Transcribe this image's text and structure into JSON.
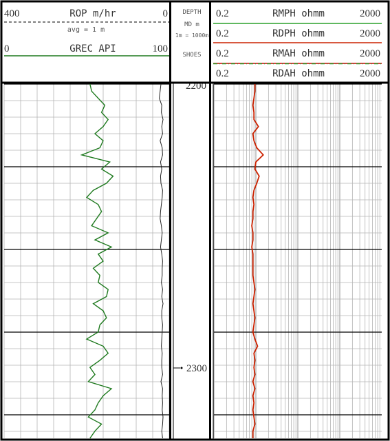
{
  "colors": {
    "frame": "#000000",
    "grid": "#b4b4b4",
    "major_grid": "#000000",
    "grec": "#1f7a1f",
    "rop": "#202020",
    "rdph": "#cc2200",
    "rmph": "#2aa02a",
    "rmah": "#cc0000",
    "rdah": "#2aa02a",
    "text": "#333333"
  },
  "header": {
    "left": {
      "rop_min": "400",
      "rop_label": "ROP m/hr",
      "rop_max": "0",
      "rop_avg": "avg = 1 m",
      "grec_min": "0",
      "grec_label": "GREC API",
      "grec_max": "100"
    },
    "depth": {
      "line1": "DEPTH",
      "line2": "MD m",
      "line3": "1m = 1000m",
      "line4": "SHOES"
    },
    "right": [
      {
        "min": "0.2",
        "label": "RMPH ohmm",
        "max": "2000"
      },
      {
        "min": "0.2",
        "label": "RDPH ohmm",
        "max": "2000"
      },
      {
        "min": "0.2",
        "label": "RMAH ohmm",
        "max": "2000"
      },
      {
        "min": "0.2",
        "label": "RDAH ohmm",
        "max": "2000"
      }
    ]
  },
  "depth_labels": [
    "2200",
    "2300"
  ],
  "chart_data": {
    "type": "line",
    "depth_range": [
      2200,
      2250
    ],
    "depth_unit": "m",
    "depth_ticks": [
      2200,
      2300
    ],
    "tracks": [
      {
        "series": [
          {
            "name": "GREC",
            "unit": "API",
            "scale": [
              0,
              100
            ],
            "depth": [
              2200.0,
              2201.0,
              2202.0,
              2203.0,
              2204.0,
              2205.0,
              2206.0,
              2207.0,
              2208.0,
              2209.0,
              2210.0,
              2211.0,
              2212.0,
              2213.0,
              2214.0,
              2215.0,
              2216.0,
              2217.0,
              2218.0,
              2219.0,
              2220.0,
              2221.0,
              2222.0,
              2223.0,
              2224.0,
              2225.0,
              2226.0,
              2227.0,
              2228.0,
              2229.0,
              2230.0,
              2231.0,
              2232.0,
              2233.0,
              2234.0,
              2235.0,
              2236.0,
              2237.0,
              2238.0,
              2239.0,
              2240.0,
              2241.0,
              2242.0,
              2243.0,
              2244.0,
              2245.0,
              2246.0,
              2247.0,
              2248.0,
              2249.0,
              2250.0
            ],
            "values": [
              52,
              53,
              57,
              61,
              59,
              63,
              60,
              55,
              60,
              58,
              47,
              64,
              59,
              66,
              62,
              54,
              50,
              57,
              59,
              56,
              53,
              63,
              55,
              65,
              57,
              60,
              54,
              58,
              57,
              63,
              62,
              54,
              60,
              62,
              58,
              57,
              50,
              60,
              63,
              58,
              52,
              55,
              51,
              65,
              60,
              57,
              55,
              51,
              59,
              55,
              52
            ]
          },
          {
            "name": "ROP",
            "unit": "m/hr",
            "scale": [
              400,
              0
            ],
            "depth": [
              2200.0,
              2201.0,
              2202.0,
              2203.0,
              2204.0,
              2205.0,
              2206.0,
              2207.0,
              2208.0,
              2209.0,
              2210.0,
              2211.0,
              2212.0,
              2213.0,
              2214.0,
              2215.0,
              2216.0,
              2217.0,
              2218.0,
              2219.0,
              2220.0,
              2221.0,
              2222.0,
              2223.0,
              2224.0,
              2225.0,
              2226.0,
              2227.0,
              2228.0,
              2229.0,
              2230.0,
              2231.0,
              2232.0,
              2233.0,
              2234.0,
              2235.0,
              2236.0,
              2237.0,
              2238.0,
              2239.0,
              2240.0,
              2241.0,
              2242.0,
              2243.0,
              2244.0,
              2245.0,
              2246.0,
              2247.0,
              2248.0,
              2249.0,
              2250.0
            ],
            "values": [
              20,
              22,
              24,
              18,
              19,
              15,
              18,
              16,
              22,
              17,
              16,
              21,
              18,
              21,
              20,
              16,
              17,
              19,
              21,
              22,
              19,
              17,
              19,
              21,
              18,
              16,
              17,
              17,
              19,
              16,
              18,
              15,
              18,
              18,
              16,
              17,
              18,
              19,
              17,
              18,
              18,
              16,
              20,
              16,
              17,
              16,
              17,
              15,
              16,
              18,
              16
            ]
          }
        ]
      },
      {
        "series": [
          {
            "name": "RMPH",
            "unit": "ohmm",
            "scale": [
              0.2,
              2000
            ],
            "log": true
          },
          {
            "name": "RDPH",
            "unit": "ohmm",
            "scale": [
              0.2,
              2000
            ],
            "log": true,
            "depth": [
              2200.0,
              2201.0,
              2202.0,
              2203.0,
              2204.0,
              2205.0,
              2206.0,
              2207.0,
              2208.0,
              2209.0,
              2210.0,
              2211.0,
              2212.0,
              2213.0,
              2214.0,
              2215.0,
              2216.0,
              2217.0,
              2218.0,
              2219.0,
              2220.0,
              2221.0,
              2222.0,
              2223.0,
              2224.0,
              2225.0,
              2226.0,
              2227.0,
              2228.0,
              2229.0,
              2230.0,
              2231.0,
              2232.0,
              2233.0,
              2234.0,
              2235.0,
              2236.0,
              2237.0,
              2238.0,
              2239.0,
              2240.0,
              2241.0,
              2242.0,
              2243.0,
              2244.0,
              2245.0,
              2246.0,
              2247.0,
              2248.0,
              2249.0,
              2250.0
            ],
            "values": [
              1.9,
              1.9,
              1.8,
              1.7,
              1.8,
              1.8,
              2.3,
              1.7,
              1.8,
              2.1,
              3.0,
              2.0,
              1.9,
              2.4,
              2.1,
              1.8,
              1.7,
              1.8,
              1.7,
              1.7,
              1.6,
              1.7,
              1.7,
              1.6,
              1.7,
              1.7,
              1.7,
              1.7,
              1.8,
              1.9,
              1.8,
              1.7,
              1.8,
              1.9,
              1.8,
              1.7,
              1.9,
              2.2,
              1.8,
              1.9,
              1.8,
              1.9,
              1.7,
              1.9,
              1.7,
              1.8,
              1.7,
              1.8,
              1.9,
              1.7,
              1.7
            ]
          },
          {
            "name": "RMAH",
            "unit": "ohmm",
            "scale": [
              0.2,
              2000
            ],
            "log": true
          },
          {
            "name": "RDAH",
            "unit": "ohmm",
            "scale": [
              0.2,
              2000
            ],
            "log": true
          }
        ]
      }
    ]
  }
}
